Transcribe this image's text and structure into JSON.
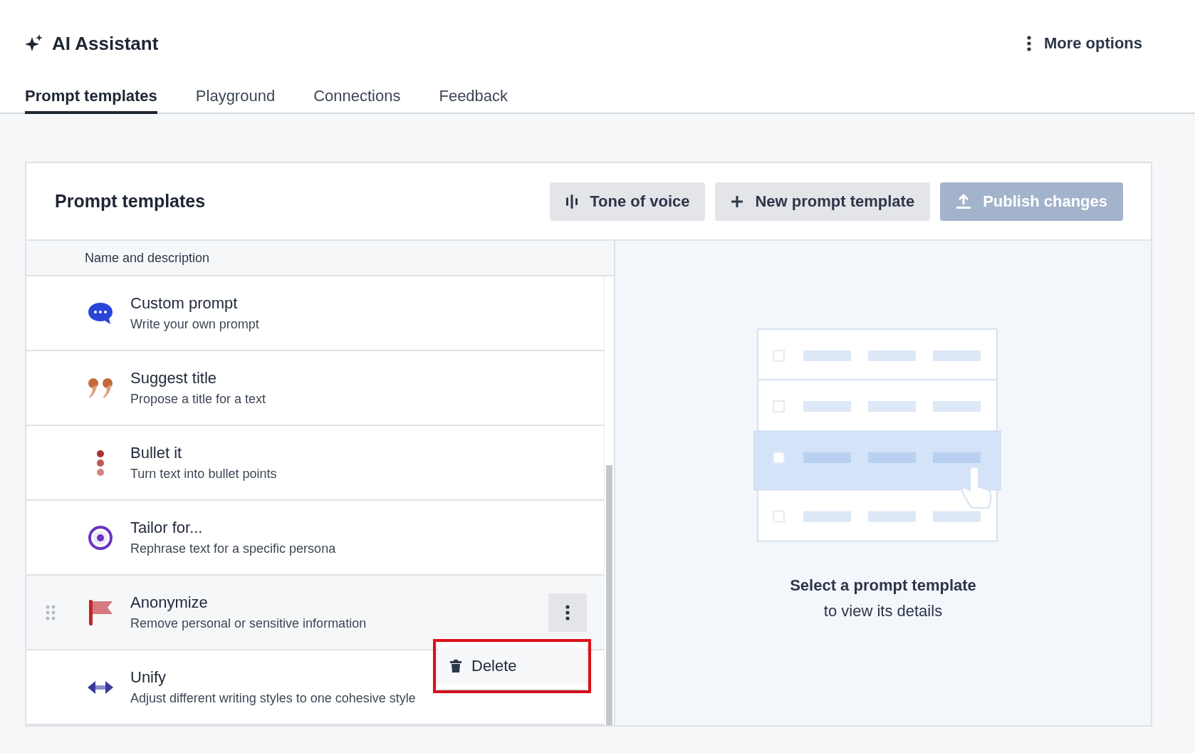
{
  "header": {
    "title": "AI Assistant",
    "more_options": "More options"
  },
  "tabs": [
    {
      "label": "Prompt templates",
      "selected": true
    },
    {
      "label": "Playground",
      "selected": false
    },
    {
      "label": "Connections",
      "selected": false
    },
    {
      "label": "Feedback",
      "selected": false
    }
  ],
  "card": {
    "title": "Prompt templates",
    "buttons": [
      {
        "label": "Tone of voice",
        "disabled": false
      },
      {
        "label": "New prompt template",
        "disabled": false
      },
      {
        "label": "Publish changes",
        "disabled": true
      }
    ]
  },
  "table": {
    "column": "Name and description",
    "rows": [
      {
        "title": "Custom prompt",
        "description": "Write your own prompt",
        "hovered": false
      },
      {
        "title": "Suggest title",
        "description": "Propose a title for a text",
        "hovered": false
      },
      {
        "title": "Bullet it",
        "description": "Turn text into bullet points",
        "hovered": false
      },
      {
        "title": "Tailor for...",
        "description": "Rephrase text for a specific persona",
        "hovered": false
      },
      {
        "title": "Anonymize",
        "description": "Remove personal or sensitive information",
        "hovered": true
      },
      {
        "title": "Unify",
        "description": "Adjust different writing styles to one cohesive style",
        "hovered": false
      }
    ]
  },
  "context_menu": {
    "items": [
      {
        "label": "Delete"
      }
    ]
  },
  "empty_state": {
    "title": "Select a prompt template",
    "subtitle": "to view its details"
  }
}
